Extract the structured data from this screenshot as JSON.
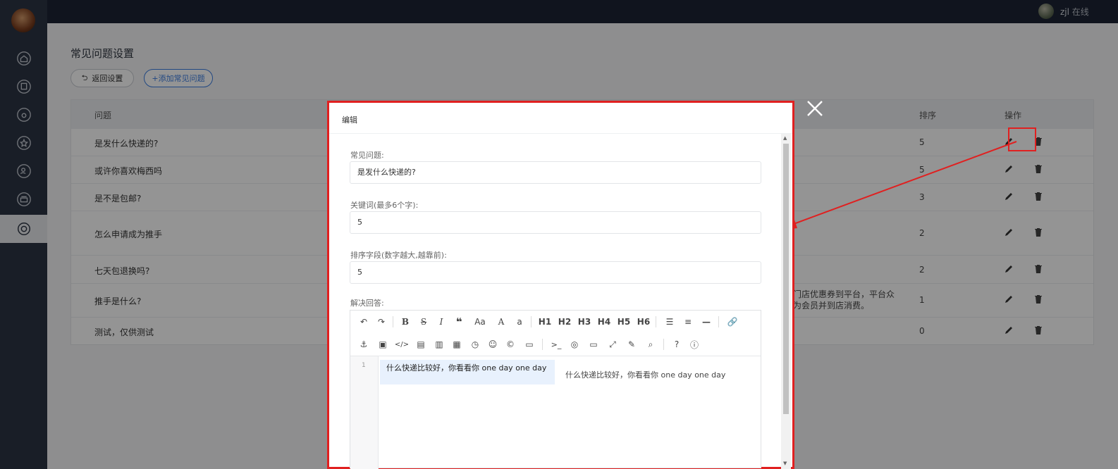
{
  "topbar": {
    "username": "zjl",
    "status": "在线"
  },
  "page": {
    "title": "常见问题设置",
    "back_label": "返回设置",
    "add_label": "+添加常见问题"
  },
  "table": {
    "headers": {
      "question": "问题",
      "sort": "排序",
      "action": "操作"
    },
    "rows": [
      {
        "question": "是发什么快递的?",
        "answer": "",
        "sort": "5"
      },
      {
        "question": "或许你喜欢梅西吗",
        "answer": "",
        "sort": "5"
      },
      {
        "question": "是不是包邮?",
        "answer": "",
        "sort": "3"
      },
      {
        "question": "怎么申请成为推手",
        "answer": "",
        "sort": "2"
      },
      {
        "question": "七天包退换吗?",
        "answer": "",
        "sort": "2"
      },
      {
        "question": "推手是什么?",
        "answer": "各门店优惠券到平台，平台众\n成为会员并到店消费。",
        "sort": "1"
      },
      {
        "question": "测试，仅供测试",
        "answer": "",
        "sort": "0"
      }
    ]
  },
  "modal": {
    "title": "编辑",
    "faq_label": "常见问题:",
    "faq_value": "是发什么快递的?",
    "keyword_label": "关键词(最多6个字):",
    "keyword_value": "5",
    "sort_label": "排序字段(数字越大,越靠前):",
    "sort_value": "5",
    "answer_label": "解决回答:",
    "editor": {
      "line_number": "1",
      "code_text": "什么快递比较好，你看看你 one day one day",
      "preview_text": "什么快递比较好，你看看你 one day one day",
      "toolbar_row1": [
        "undo-icon",
        "redo-icon",
        "bold-icon",
        "strikethrough-icon",
        "italic-icon",
        "quote-icon",
        "font-case-icon",
        "uppercase-icon",
        "lowercase-icon",
        "h1",
        "h2",
        "h3",
        "h4",
        "h5",
        "h6",
        "unordered-list-icon",
        "ordered-list-icon",
        "horizontal-rule-icon",
        "link-icon"
      ],
      "toolbar_row2": [
        "anchor-icon",
        "image-icon",
        "code-icon",
        "code-block-icon",
        "preformatted-icon",
        "table-icon",
        "datetime-icon",
        "emoji-icon",
        "html-entities-icon",
        "pagebreak-icon",
        "terminal-icon",
        "watch-icon",
        "preview-icon",
        "fullscreen-icon",
        "clear-icon",
        "search-icon",
        "help-icon",
        "info-icon"
      ],
      "heading_labels": [
        "H1",
        "H2",
        "H3",
        "H4",
        "H5",
        "H6"
      ]
    }
  },
  "colors": {
    "sidebar": "#2c3444",
    "accent_blue": "#3b7ce0",
    "annotation_red": "#e02020"
  }
}
